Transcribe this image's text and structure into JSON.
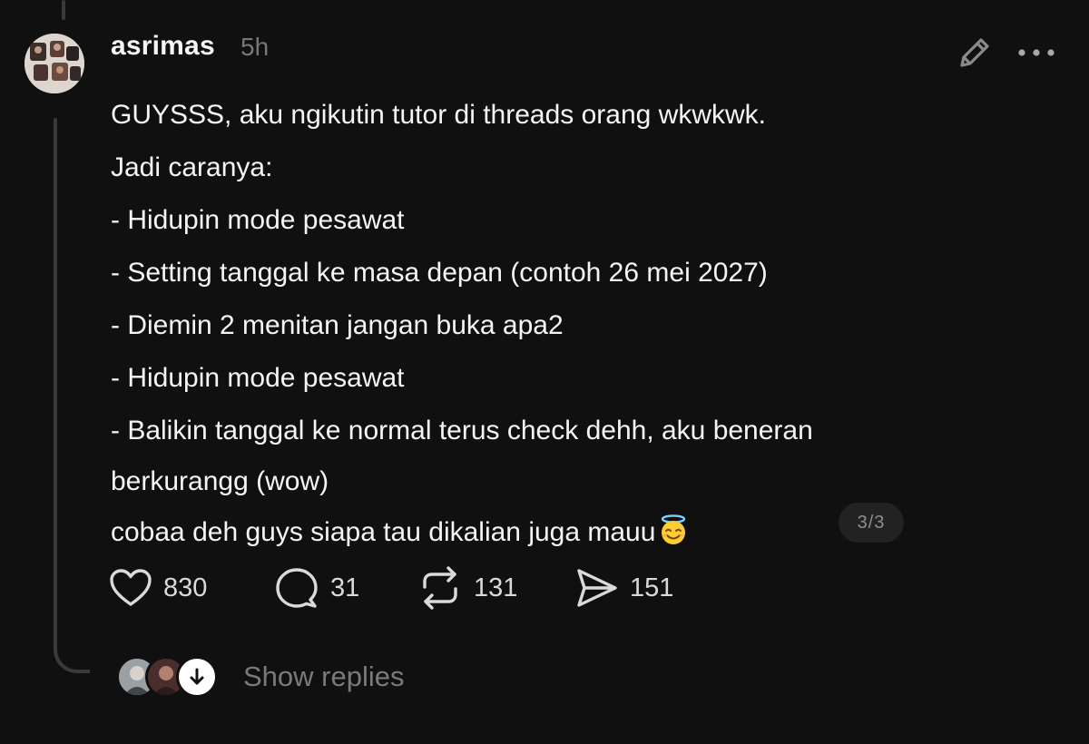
{
  "post": {
    "username": "asrimas",
    "timestamp": "5h",
    "lines": [
      "GUYSSS, aku ngikutin tutor di threads orang wkwkwk.",
      "Jadi caranya:",
      "- Hidupin mode pesawat",
      "- Setting tanggal ke masa depan (contoh 26 mei 2027)",
      "- Diemin 2 menitan jangan buka apa2",
      "- Hidupin mode pesawat",
      "- Balikin tanggal ke normal terus check dehh, aku beneran",
      "berkurangg (wow)",
      "cobaa deh guys siapa tau dikalian juga mauu"
    ],
    "emoji": "smiling-face-with-halo",
    "page_indicator": "3/3"
  },
  "actions": {
    "likes": "830",
    "comments": "31",
    "reposts": "131",
    "shares": "151"
  },
  "replies": {
    "label": "Show replies"
  },
  "icons": {
    "edit": "pencil-icon",
    "more": "more-horizontal-icon",
    "like": "heart-icon",
    "comment": "comment-bubble-icon",
    "repost": "repost-icon",
    "share": "send-icon",
    "expand": "arrow-down-icon"
  },
  "colors": {
    "background": "#101010",
    "text": "#f3f5f7",
    "muted": "#777777",
    "thread_line": "#3a3a3a"
  }
}
